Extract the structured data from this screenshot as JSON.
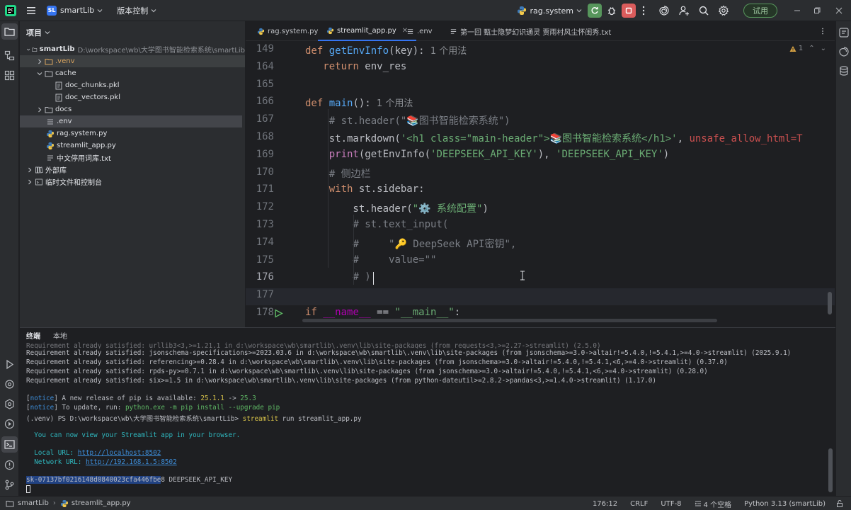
{
  "titlebar": {
    "project_badge": "SL",
    "project_name": "smartLib",
    "vcs_label": "版本控制",
    "run_config": "rag.system",
    "trial_label": "试用"
  },
  "project_panel": {
    "title": "项目",
    "tree": [
      {
        "label": "smartLib",
        "path": "D:\\workspace\\wb\\大学图书智能检索系统\\smartLib"
      },
      {
        "label": ".venv"
      },
      {
        "label": "cache"
      },
      {
        "label": "doc_chunks.pkl"
      },
      {
        "label": "doc_vectors.pkl"
      },
      {
        "label": "docs"
      },
      {
        "label": ".env"
      },
      {
        "label": "rag.system.py"
      },
      {
        "label": "streamlit_app.py"
      },
      {
        "label": "中文停用词库.txt"
      },
      {
        "label": "外部库"
      },
      {
        "label": "临时文件和控制台"
      }
    ]
  },
  "editor": {
    "tabs": [
      {
        "label": "rag.system.py"
      },
      {
        "label": "streamlit_app.py"
      },
      {
        "label": ".env"
      },
      {
        "label": "第一回 甄士隐梦幻识通灵 贾雨村风尘怀闺秀.txt"
      }
    ],
    "inspection": "1",
    "lines": [
      {
        "n": "149",
        "segments": [
          [
            "kw",
            "def "
          ],
          [
            "fn",
            "getEnvInfo"
          ],
          [
            "param",
            "(key):"
          ],
          [
            "hint",
            "  1 个用法"
          ]
        ]
      },
      {
        "n": "164",
        "segments": [
          [
            "param",
            "   "
          ],
          [
            "kw",
            "return"
          ],
          [
            "param",
            " env_res"
          ]
        ]
      },
      {
        "n": "165",
        "segments": []
      },
      {
        "n": "166",
        "segments": [
          [
            "kw",
            "def "
          ],
          [
            "fn",
            "main"
          ],
          [
            "param",
            "():"
          ],
          [
            "hint",
            "  1 个用法"
          ]
        ]
      },
      {
        "n": "167",
        "segments": [
          [
            "param",
            "    "
          ],
          [
            "cm",
            "# st.header(\"📚图书智能检索系统\")"
          ]
        ]
      },
      {
        "n": "168",
        "segments": [
          [
            "param",
            "    st.markdown("
          ],
          [
            "str",
            "'<h1 class=\"main-header\">📚图书智能检索系统</h1>'"
          ],
          [
            "param",
            ", "
          ],
          [
            "redund",
            "unsafe_allow_html=T"
          ]
        ]
      },
      {
        "n": "169",
        "segments": [
          [
            "param",
            "    "
          ],
          [
            "warn",
            "print"
          ],
          [
            "param",
            "(getEnvInfo("
          ],
          [
            "str",
            "'DEEPSEEK_API_KEY'"
          ],
          [
            "param",
            "), "
          ],
          [
            "str",
            "'DEEPSEEK_API_KEY'"
          ],
          [
            "param",
            ")"
          ]
        ]
      },
      {
        "n": "170",
        "segments": [
          [
            "param",
            "    "
          ],
          [
            "cm",
            "# 侧边栏"
          ]
        ]
      },
      {
        "n": "171",
        "segments": [
          [
            "param",
            "    "
          ],
          [
            "kw",
            "with"
          ],
          [
            "param",
            " st.sidebar:"
          ]
        ]
      },
      {
        "n": "172",
        "segments": [
          [
            "param",
            "        st.header("
          ],
          [
            "str",
            "\"⚙️ 系统配置\""
          ],
          [
            "param",
            ")"
          ]
        ]
      },
      {
        "n": "173",
        "segments": [
          [
            "param",
            "        "
          ],
          [
            "cm",
            "# st.text_input("
          ]
        ]
      },
      {
        "n": "174",
        "segments": [
          [
            "param",
            "        "
          ],
          [
            "cm",
            "#     \"🔑 DeepSeek API密钥\","
          ]
        ]
      },
      {
        "n": "175",
        "segments": [
          [
            "param",
            "        "
          ],
          [
            "cm",
            "#     value=\"\""
          ]
        ]
      },
      {
        "n": "176",
        "segments": [
          [
            "param",
            "        "
          ],
          [
            "cm",
            "# )"
          ]
        ]
      },
      {
        "n": "177",
        "segments": []
      },
      {
        "n": "178",
        "segments": [
          [
            "kw",
            "if "
          ],
          [
            "dunder",
            "__name__"
          ],
          [
            "param",
            " == "
          ],
          [
            "str",
            "\"__main__\""
          ],
          [
            "param",
            ":"
          ]
        ]
      }
    ]
  },
  "terminal": {
    "tabs": [
      "终端",
      "本地"
    ],
    "lines": [
      {
        "cls": "",
        "text": "Requirement already satisfied: urllib3<3,>=1.21.1 in d:\\workspace\\wb\\smartlib\\.venv\\lib\\site-packages (from requests<3,>=2.27->streamlit) (2.5.0)"
      },
      {
        "cls": "",
        "text": "Requirement already satisfied: jsonschema-specifications>=2023.03.6 in d:\\workspace\\wb\\smartlib\\.venv\\lib\\site-packages (from jsonschema>=3.0->altair!=5.4.0,!=5.4.1,>=4.0->streamlit) (2025.9.1)"
      },
      {
        "cls": "",
        "text": "Requirement already satisfied: referencing>=0.28.4 in d:\\workspace\\wb\\smartlib\\.venv\\lib\\site-packages (from jsonschema>=3.0->altair!=5.4.0,!=5.4.1,<6,>=4.0->streamlit) (0.37.0)"
      },
      {
        "cls": "",
        "text": "Requirement already satisfied: rpds-py>=0.7.1 in d:\\workspace\\wb\\smartlib\\.venv\\lib\\site-packages (from jsonschema>=3.0->altair!=5.4.0,!=5.4.1,<6,>=4.0->streamlit) (0.28.0)"
      },
      {
        "cls": "",
        "text": "Requirement already satisfied: six>=1.5 in d:\\workspace\\wb\\smartlib\\.venv\\lib\\site-packages (from python-dateutil>=2.8.2->pandas<3,>=1.4.0->streamlit) (1.17.0)"
      }
    ],
    "notice1_tag": "notice",
    "notice1_text": " A new release of pip is available: ",
    "notice1_old": "25.1.1",
    "notice1_arrow": " -> ",
    "notice1_new": "25.3",
    "notice2_tag": "notice",
    "notice2_text": " To update, run: ",
    "notice2_cmd": "python.exe -m pip install --upgrade pip",
    "prompt": "(.venv) PS D:\\workspace\\wb\\大学图书智能检索系统\\smartLib> ",
    "prompt_cmd": "streamlit",
    "prompt_args": " run streamlit_app.py",
    "view_msg": "  You can now view your Streamlit app in your browser.",
    "local_label": "  Local URL: ",
    "local_url": "http://localhost:8502",
    "network_label": "  Network URL: ",
    "network_url": "http://192.168.1.5:8502",
    "key_selected": "sk-07137bf0216148d0840023cfa446fbe",
    "key_rest": "8 DEEPSEEK_API_KEY"
  },
  "statusbar": {
    "crumb_project": "smartLib",
    "crumb_file": "streamlit_app.py",
    "position": "176:12",
    "line_sep": "CRLF",
    "encoding": "UTF-8",
    "indent": "4 个空格",
    "interpreter": "Python 3.13 (smartLib)"
  }
}
